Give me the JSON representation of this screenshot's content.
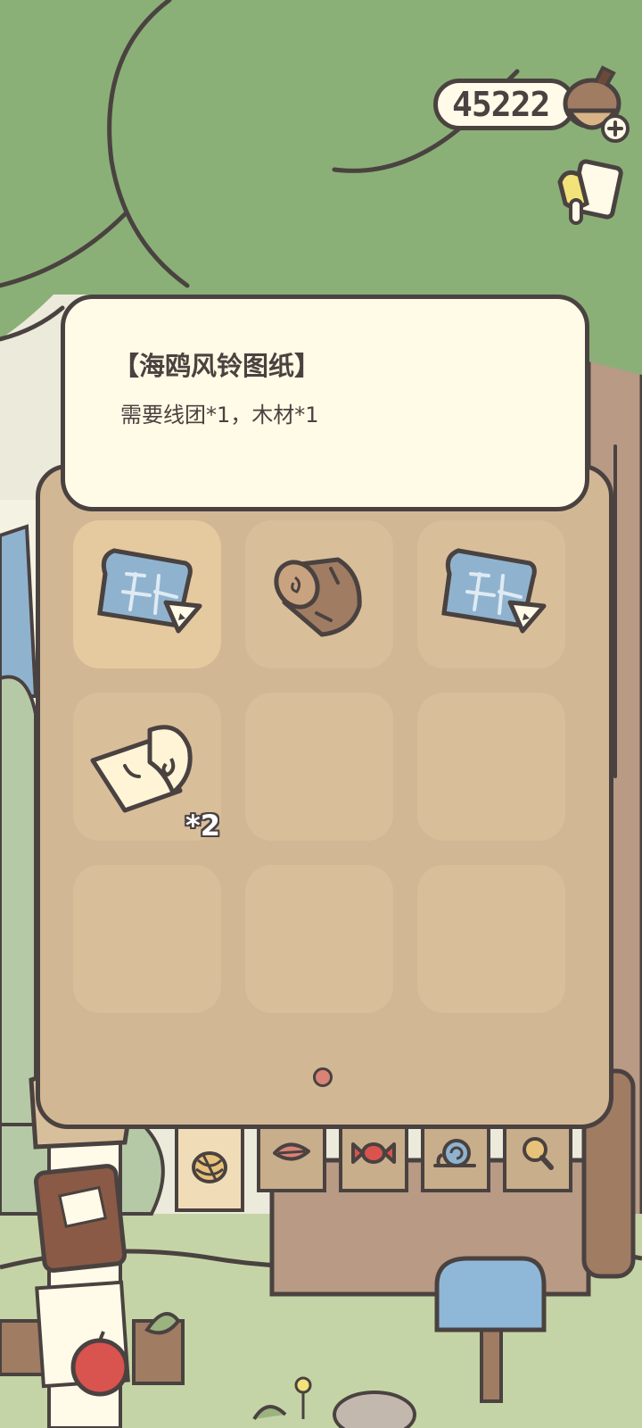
{
  "currency": {
    "amount": "45222",
    "icon": "acorn-plus-icon"
  },
  "journal": {
    "icon": "journal-icon"
  },
  "tooltip": {
    "title": "【海鸥风铃图纸】",
    "description": "需要线团*1，木材*1"
  },
  "inventory": {
    "slots": [
      {
        "icon": "blueprint-icon",
        "count": "",
        "selected": true
      },
      {
        "icon": "wood-log-icon",
        "count": ""
      },
      {
        "icon": "blueprint-icon",
        "count": ""
      },
      {
        "icon": "paper-scroll-icon",
        "count": "*2"
      },
      {
        "icon": "",
        "count": ""
      },
      {
        "icon": "",
        "count": ""
      },
      {
        "icon": "",
        "count": ""
      },
      {
        "icon": "",
        "count": ""
      },
      {
        "icon": "",
        "count": ""
      }
    ],
    "page_indicator": {
      "current": 1,
      "total": 1
    }
  },
  "tabs": [
    {
      "icon": "yarn-ball-icon",
      "active": true
    },
    {
      "icon": "leaf-icon",
      "active": false
    },
    {
      "icon": "candy-icon",
      "active": false
    },
    {
      "icon": "snail-icon",
      "active": false
    },
    {
      "icon": "magnifier-icon",
      "active": false
    }
  ],
  "colors": {
    "outline": "#4a4240",
    "panel": "#d2b794",
    "tooltip_bg": "#fffbe6",
    "canopy": "#8ab077",
    "accent_dot": "#d98377"
  }
}
